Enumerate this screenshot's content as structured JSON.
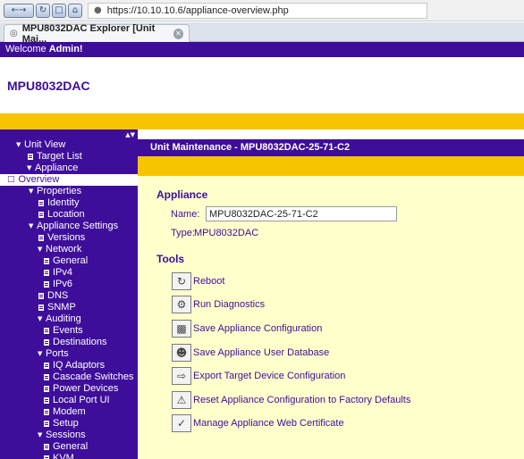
{
  "browser": {
    "url": "https://10.10.10.6/appliance-overview.php",
    "tab_title": "MPU8032DAC Explorer [Unit Mai..."
  },
  "header": {
    "welcome_prefix": "Welcome ",
    "welcome_user": "Admin!",
    "app_title": "MPU8032DAC"
  },
  "sidebar": {
    "items": [
      {
        "label": "Unit View",
        "type": "folder"
      },
      {
        "label": "Target List",
        "type": "leaf"
      },
      {
        "label": "Appliance",
        "type": "folder"
      },
      {
        "label": "Overview",
        "type": "selected"
      },
      {
        "label": "Properties",
        "type": "folder"
      },
      {
        "label": "Identity",
        "type": "leaf"
      },
      {
        "label": "Location",
        "type": "leaf"
      },
      {
        "label": "Appliance Settings",
        "type": "folder"
      },
      {
        "label": "Versions",
        "type": "leaf"
      },
      {
        "label": "Network",
        "type": "folder"
      },
      {
        "label": "General",
        "type": "leaf"
      },
      {
        "label": "IPv4",
        "type": "leaf"
      },
      {
        "label": "IPv6",
        "type": "leaf"
      },
      {
        "label": "DNS",
        "type": "leaf"
      },
      {
        "label": "SNMP",
        "type": "leaf"
      },
      {
        "label": "Auditing",
        "type": "folder"
      },
      {
        "label": "Events",
        "type": "leaf"
      },
      {
        "label": "Destinations",
        "type": "leaf"
      },
      {
        "label": "Ports",
        "type": "folder"
      },
      {
        "label": "IQ Adaptors",
        "type": "leaf"
      },
      {
        "label": "Cascade Switches",
        "type": "leaf"
      },
      {
        "label": "Power Devices",
        "type": "leaf"
      },
      {
        "label": "Local Port UI",
        "type": "leaf"
      },
      {
        "label": "Modem",
        "type": "leaf"
      },
      {
        "label": "Setup",
        "type": "leaf"
      },
      {
        "label": "Sessions",
        "type": "folder"
      },
      {
        "label": "General",
        "type": "leaf"
      },
      {
        "label": "KVM",
        "type": "leaf"
      }
    ]
  },
  "main": {
    "section_title": "Unit Maintenance - MPU8032DAC-25-71-C2",
    "appliance_heading": "Appliance",
    "name_label": "Name:",
    "name_value": "MPU8032DAC-25-71-C2",
    "type_label": "Type:",
    "type_value": "MPU8032DAC",
    "tools_heading": "Tools",
    "tools": [
      {
        "label": "Reboot",
        "icon": "reboot-icon"
      },
      {
        "label": "Run Diagnostics",
        "icon": "diagnostics-icon"
      },
      {
        "label": "Save Appliance Configuration",
        "icon": "save-config-icon"
      },
      {
        "label": "Save Appliance User Database",
        "icon": "save-userdb-icon"
      },
      {
        "label": "Export Target Device Configuration",
        "icon": "export-icon"
      },
      {
        "label": "Reset Appliance Configuration to Factory Defaults",
        "icon": "reset-icon"
      },
      {
        "label": "Manage Appliance Web Certificate",
        "icon": "certificate-icon"
      }
    ]
  }
}
